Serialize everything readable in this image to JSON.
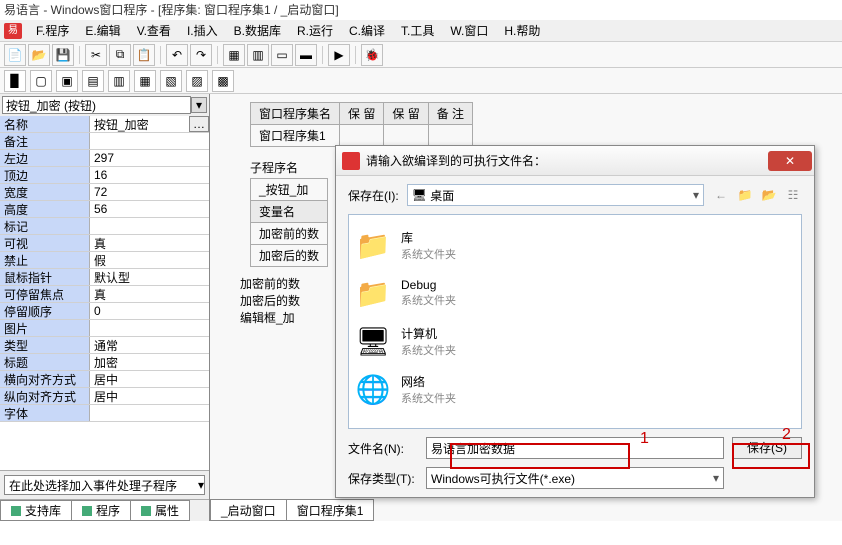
{
  "title": "易语言 - Windows窗口程序 - [程序集: 窗口程序集1 / _启动窗口]",
  "menu": [
    "F.程序",
    "E.编辑",
    "V.查看",
    "I.插入",
    "B.数据库",
    "R.运行",
    "C.编译",
    "T.工具",
    "W.窗口",
    "H.帮助"
  ],
  "combo": "按钮_加密 (按钮)",
  "props": [
    {
      "n": "名称",
      "v": "按钮_加密",
      "btn": true
    },
    {
      "n": "备注",
      "v": ""
    },
    {
      "n": "左边",
      "v": "297"
    },
    {
      "n": "顶边",
      "v": "16"
    },
    {
      "n": "宽度",
      "v": "72"
    },
    {
      "n": "高度",
      "v": "56"
    },
    {
      "n": "标记",
      "v": ""
    },
    {
      "n": "可视",
      "v": "真"
    },
    {
      "n": "禁止",
      "v": "假"
    },
    {
      "n": "鼠标指针",
      "v": "默认型"
    },
    {
      "n": "可停留焦点",
      "v": "真"
    },
    {
      "n": "  停留顺序",
      "v": "0"
    },
    {
      "n": "图片",
      "v": ""
    },
    {
      "n": "类型",
      "v": "通常"
    },
    {
      "n": "标题",
      "v": "加密"
    },
    {
      "n": "横向对齐方式",
      "v": "居中"
    },
    {
      "n": "纵向对齐方式",
      "v": "居中"
    },
    {
      "n": "字体",
      "v": ""
    }
  ],
  "event_placeholder": "在此处选择加入事件处理子程序",
  "tabs": {
    "support": "支持库",
    "program": "程序",
    "prop": "属性"
  },
  "top_table": {
    "headers": [
      "窗口程序集名",
      "保 留",
      "保 留",
      "备 注"
    ],
    "row": [
      "窗口程序集1",
      "",
      "",
      ""
    ]
  },
  "sub_label": "子程序名",
  "sub_row": "_按钮_加",
  "var_header": "变量名",
  "vars": [
    "加密前的数",
    "加密后的数"
  ],
  "plain_vars": [
    "加密前的数",
    "加密后的数",
    "编辑框_加"
  ],
  "dialog": {
    "title": "请输入欲编译到的可执行文件名：",
    "save_in": "保存在(I):",
    "desktop": "桌面",
    "items": [
      {
        "t": "库",
        "s": "系统文件夹"
      },
      {
        "t": "Debug",
        "s": "系统文件夹"
      },
      {
        "t": "计算机",
        "s": "系统文件夹"
      },
      {
        "t": "网络",
        "s": "系统文件夹"
      }
    ],
    "file_name_label": "文件名(N):",
    "file_name_value": "易语言加密数据",
    "file_type_label": "保存类型(T):",
    "file_type_value": "Windows可执行文件(*.exe)",
    "save_btn": "保存(S)"
  },
  "bottom_tabs": [
    "_启动窗口",
    "窗口程序集1"
  ],
  "marks": {
    "one": "1",
    "two": "2"
  }
}
